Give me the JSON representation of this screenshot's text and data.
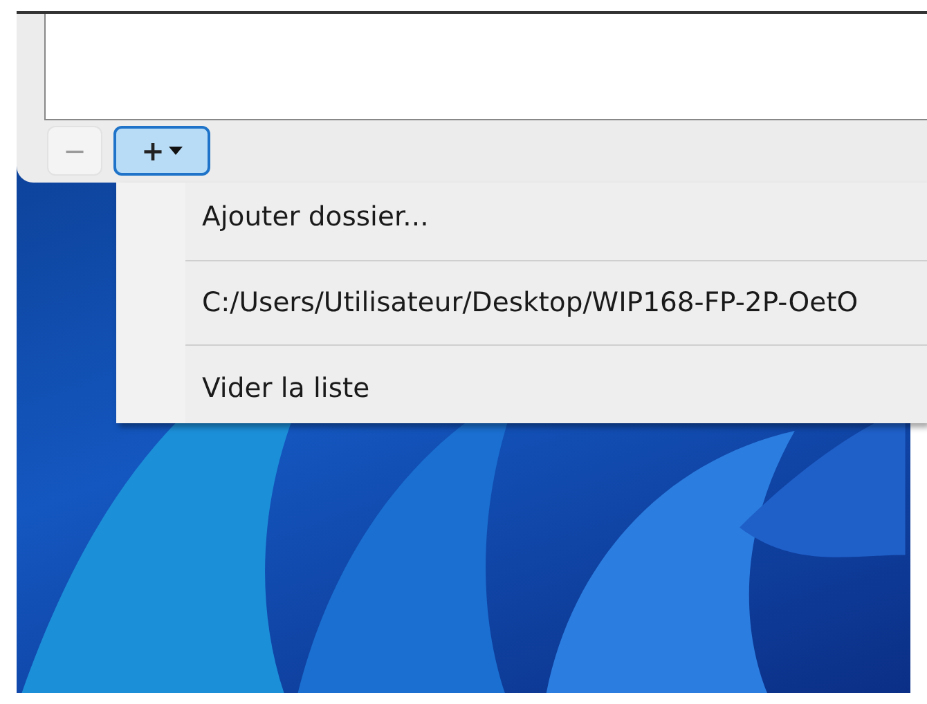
{
  "toolbar": {
    "buttons": [
      {
        "label": "−",
        "disabled": true,
        "pressed": false,
        "menu": false
      },
      {
        "label": "+",
        "disabled": false,
        "pressed": true,
        "menu": true
      }
    ]
  },
  "menu": {
    "items": [
      {
        "label": "Ajouter dossier..."
      },
      {
        "label": "C:/Users/Utilisateur/Desktop/WIP168-FP-2P-OetO"
      },
      {
        "label": "Vider la liste"
      }
    ]
  }
}
